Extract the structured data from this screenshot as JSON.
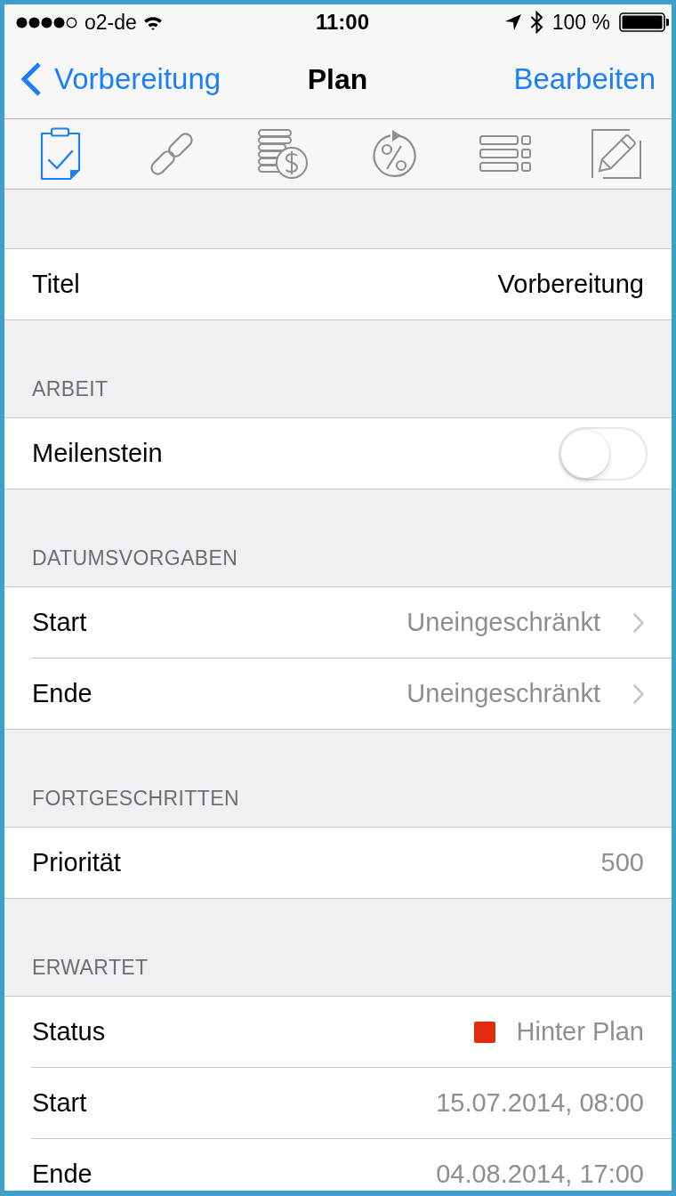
{
  "status_bar": {
    "carrier": "o2-de",
    "time": "11:00",
    "battery": "100 %"
  },
  "nav_bar": {
    "back": "Vorbereitung",
    "title": "Plan",
    "action": "Bearbeiten"
  },
  "toolbar": [
    {
      "kind": "clipboard",
      "selected": true
    },
    {
      "kind": "link",
      "selected": false
    },
    {
      "kind": "coins",
      "selected": false
    },
    {
      "kind": "percent",
      "selected": false
    },
    {
      "kind": "list",
      "selected": false
    },
    {
      "kind": "edit",
      "selected": false
    }
  ],
  "sections": [
    {
      "rows": [
        {
          "kind": "text",
          "label": "Titel",
          "value": "Vorbereitung"
        }
      ]
    },
    {
      "header": "ARBEIT",
      "rows": [
        {
          "kind": "toggle",
          "label": "Meilenstein",
          "on": false
        }
      ]
    },
    {
      "header": "DATUMSVORGABEN",
      "rows": [
        {
          "kind": "disclosure",
          "label": "Start",
          "value": "Uneingeschränkt"
        },
        {
          "kind": "disclosure",
          "label": "Ende",
          "value": "Uneingeschränkt"
        }
      ]
    },
    {
      "header": "FORTGESCHRITTEN",
      "rows": [
        {
          "kind": "detail",
          "label": "Priorität",
          "value": "500"
        }
      ]
    },
    {
      "header": "ERWARTET",
      "rows": [
        {
          "kind": "status",
          "label": "Status",
          "value": "Hinter Plan",
          "color": "#e42a0c"
        },
        {
          "kind": "detail",
          "label": "Start",
          "value": "15.07.2014, 08:00"
        },
        {
          "kind": "detail",
          "label": "Ende",
          "value": "04.08.2014, 17:00"
        }
      ]
    }
  ]
}
